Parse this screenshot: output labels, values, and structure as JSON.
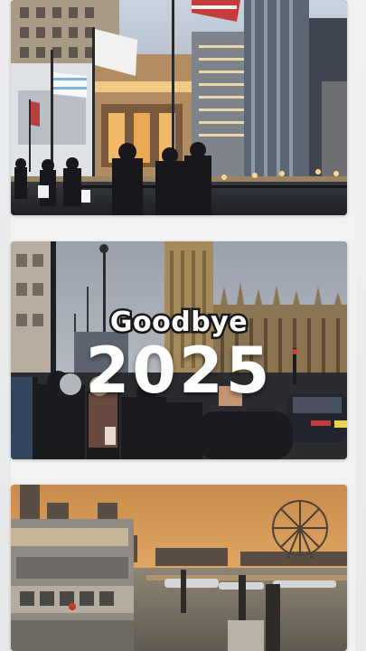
{
  "reel": {
    "items": [
      {
        "id": "chicago-riverwalk"
      },
      {
        "id": "london-westminster",
        "overlay": {
          "line1": "Goodbye",
          "line2": "2025"
        }
      },
      {
        "id": "harbor-sunset"
      }
    ]
  },
  "colors": {
    "page_background": "#f2f2f1",
    "overlay_text": "#ffffff",
    "overlay_outline": "#1a1a1a"
  }
}
